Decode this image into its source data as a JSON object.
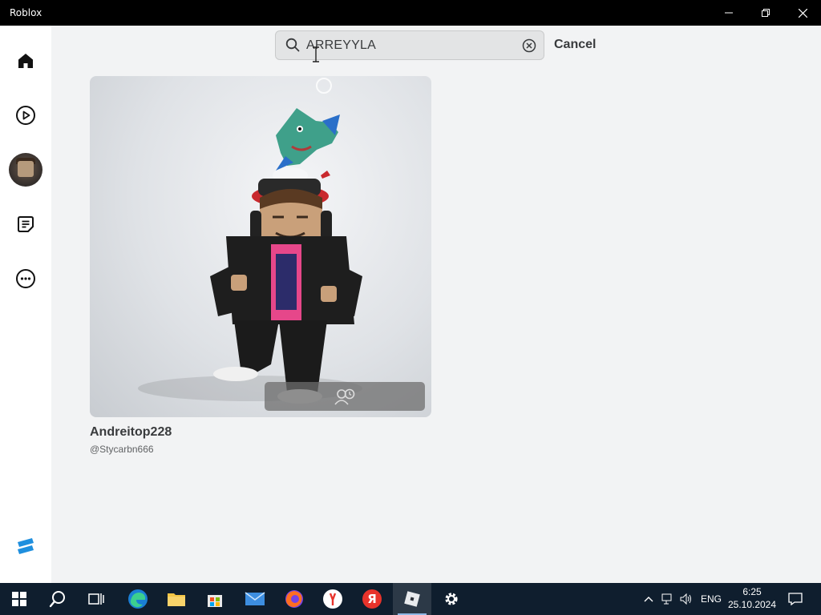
{
  "window": {
    "title": "Roblox"
  },
  "search": {
    "value": "ARREYYLA",
    "cancel_label": "Cancel"
  },
  "result": {
    "display_name": "Andreitop228",
    "username": "@Stycarbn666"
  },
  "sidebar": {
    "items": [
      {
        "name": "home",
        "icon": "home-icon"
      },
      {
        "name": "play",
        "icon": "play-icon"
      },
      {
        "name": "avatar",
        "icon": "avatar"
      },
      {
        "name": "chat",
        "icon": "chat-icon"
      },
      {
        "name": "more",
        "icon": "more-icon"
      }
    ],
    "logo": "roblox-studio-icon"
  },
  "taskbar": {
    "language": "ENG",
    "time": "6:25",
    "date": "25.10.2024"
  },
  "colors": {
    "accent": "#393b3d",
    "taskbar": "#0f1e2e",
    "sidebar": "#ffffff"
  }
}
